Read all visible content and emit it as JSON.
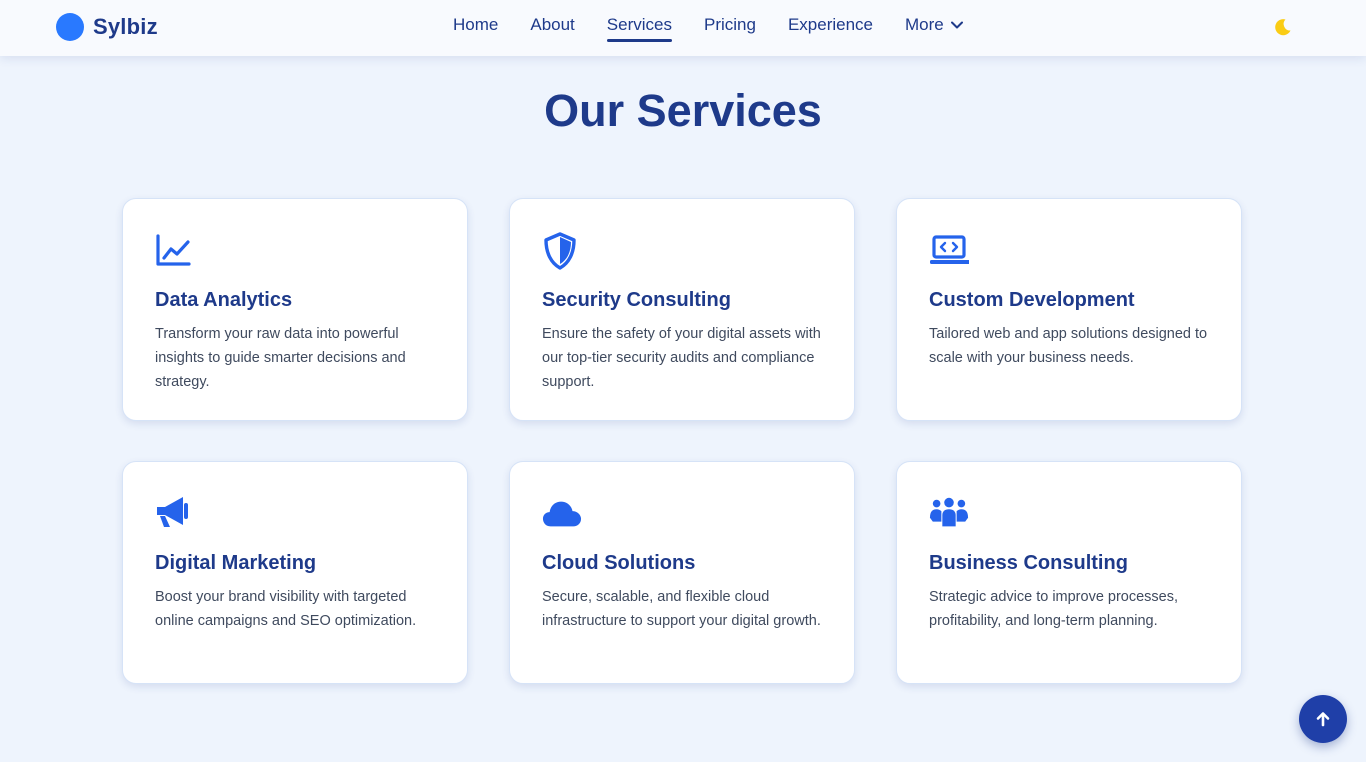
{
  "brand": {
    "name": "Sylbiz",
    "color": "#2979ff"
  },
  "nav": {
    "links": [
      {
        "label": "Home",
        "active": false
      },
      {
        "label": "About",
        "active": false
      },
      {
        "label": "Services",
        "active": true
      },
      {
        "label": "Pricing",
        "active": false
      },
      {
        "label": "Experience",
        "active": false
      },
      {
        "label": "More",
        "active": false,
        "icon": "chevron-down-icon"
      }
    ],
    "theme_toggle_icon": "moon-icon"
  },
  "section": {
    "title": "Our Services"
  },
  "services": [
    {
      "icon": "chart-line-icon",
      "title": "Data Analytics",
      "description": "Transform your raw data into powerful insights to guide smarter decisions and strategy."
    },
    {
      "icon": "shield-icon",
      "title": "Security Consulting",
      "description": "Ensure the safety of your digital assets with our top-tier security audits and compliance support."
    },
    {
      "icon": "laptop-code-icon",
      "title": "Custom Development",
      "description": "Tailored web and app solutions designed to scale with your business needs."
    },
    {
      "icon": "megaphone-icon",
      "title": "Digital Marketing",
      "description": "Boost your brand visibility with targeted online campaigns and SEO optimization."
    },
    {
      "icon": "cloud-icon",
      "title": "Cloud Solutions",
      "description": "Secure, scalable, and flexible cloud infrastructure to support your digital growth."
    },
    {
      "icon": "users-icon",
      "title": "Business Consulting",
      "description": "Strategic advice to improve processes, profitability, and long-term planning."
    }
  ],
  "scroll_top": {
    "icon": "arrow-up-icon"
  },
  "colors": {
    "accent": "#2563eb",
    "heading": "#1e3a8a",
    "background": "#eef4fd",
    "moon": "#facc15"
  }
}
